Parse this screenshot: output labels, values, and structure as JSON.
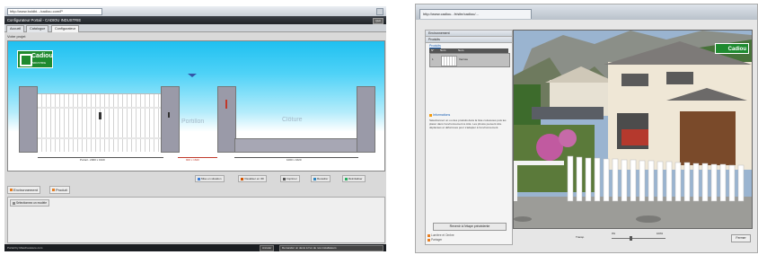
{
  "left_window": {
    "url": "http://www.boldbi.../cadiou.com/P",
    "app_title": "Configurateur Portail - CADIOU INDUSTRIE",
    "quit_label": "Quit",
    "tabs": [
      "Accueil",
      "Catalogue",
      "Configurateur"
    ],
    "active_tab": 2,
    "project_label": "Votre projet",
    "logo": {
      "name": "Cadiou",
      "sub": "INDUSTRIE"
    },
    "zone_labels": {
      "portillon": "Portillon",
      "cloture": "Clôture"
    },
    "dimensions": {
      "gate": "Portail - 2000 x 1620",
      "gap": "900 x 1620",
      "fence": "1000 x 1620"
    },
    "toolbar": [
      {
        "label": "Mise en situation",
        "icon": "photo-icon"
      },
      {
        "label": "Visualiser en 3D",
        "icon": "cube-icon"
      },
      {
        "label": "Imprimer",
        "icon": "print-icon"
      },
      {
        "label": "Recadrer",
        "icon": "crop-icon"
      },
      {
        "label": "Réinitialiser",
        "icon": "reset-icon"
      }
    ],
    "panel_tabs": [
      {
        "label": "Environnement",
        "icon": "env-icon"
      },
      {
        "label": "Produit",
        "icon": "product-icon"
      }
    ],
    "panel_item": "Sélectionnez un modèle",
    "status_left": "Portail by Maschaussure.com",
    "status_buttons": [
      "Annuler",
      "Demander un devis à l'un de nos installateurs"
    ],
    "colors": {
      "sky": "#1fc0f0",
      "pillar": "#9a9aa8",
      "logo": "#1e8a2f"
    }
  },
  "right_window": {
    "url": "http://www.cadiou...fr/site/cadiou/...",
    "sections": {
      "environment": "Environnement",
      "products": "Produits",
      "info": "Informations"
    },
    "product_link": "Produits",
    "columns": [
      "N°",
      "Nom",
      "Nom"
    ],
    "product_row": {
      "index": "1",
      "name": "Vercoie"
    },
    "info_text": "Sélectionnez un ou des produits dans la liste ci-dessous puis les placer dans l'environnement à côté. Les photos peuvent être déplacées et déformées pour s'adapter à l'environnement.",
    "reset_label": "Revenir à l'étape précédente",
    "bottom_sections": [
      "Lumière et Ombre",
      "Partager"
    ],
    "zoom_label": "Transp.",
    "zoom_values": {
      "min": "0%",
      "max": "100%"
    },
    "close_label": "Fermer",
    "logo": "Cadiou"
  }
}
